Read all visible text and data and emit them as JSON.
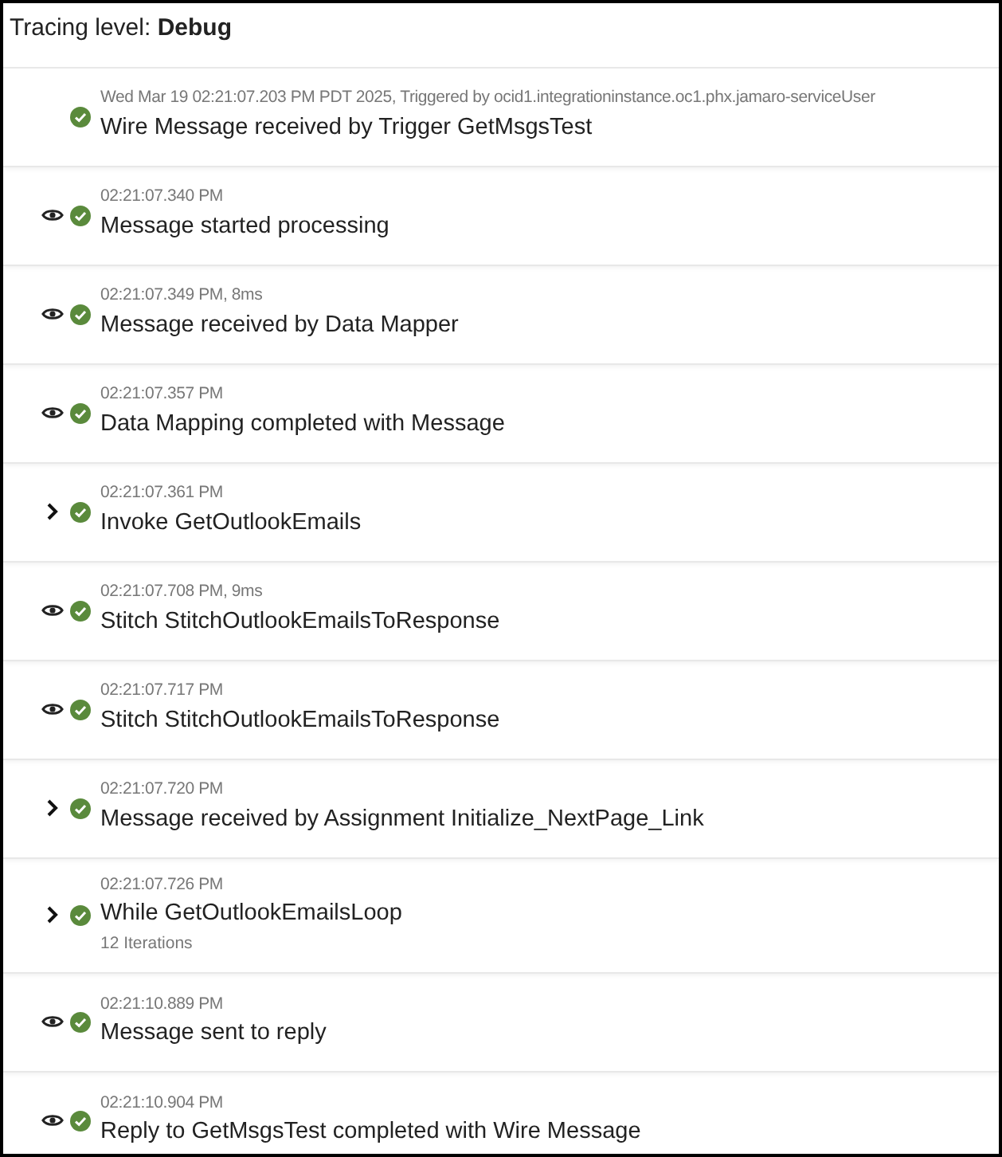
{
  "tracing_level": "Tracing level: **Debug**",
  "events": [
    {
      "kind": "none",
      "time": "Wed Mar 19 02:21:07.203 PM PDT 2025, Triggered by ocid1.integrationinstance.oc1.phx.jamaro-serviceUser",
      "title": "Wire Message received by Trigger GetMsgsTest"
    },
    {
      "kind": "eye",
      "time": "02:21:07.340 PM",
      "title": "Message started processing"
    },
    {
      "kind": "eye",
      "time": "02:21:07.349 PM, 8ms",
      "title": "Message received by Data Mapper"
    },
    {
      "kind": "eye",
      "time": "02:21:07.357 PM",
      "title": "Data Mapping completed with Message"
    },
    {
      "kind": "expand",
      "time": "02:21:07.361 PM",
      "title": "Invoke GetOutlookEmails"
    },
    {
      "kind": "eye",
      "time": "02:21:07.708 PM, 9ms",
      "title": "Stitch StitchOutlookEmailsToResponse"
    },
    {
      "kind": "eye",
      "time": "02:21:07.717 PM",
      "title": "Stitch StitchOutlookEmailsToResponse"
    },
    {
      "kind": "expand",
      "time": "02:21:07.720 PM",
      "title": "Message received by Assignment Initialize_NextPage_Link"
    },
    {
      "kind": "expand",
      "time": "02:21:07.726 PM",
      "title": "While GetOutlookEmailsLoop",
      "note": "12 Iterations"
    },
    {
      "kind": "eye",
      "time": "02:21:10.889 PM",
      "title": "Message sent to reply"
    },
    {
      "kind": "eye",
      "time": "02:21:10.904 PM",
      "title": "Reply to GetMsgsTest completed with Wire Message"
    }
  ]
}
